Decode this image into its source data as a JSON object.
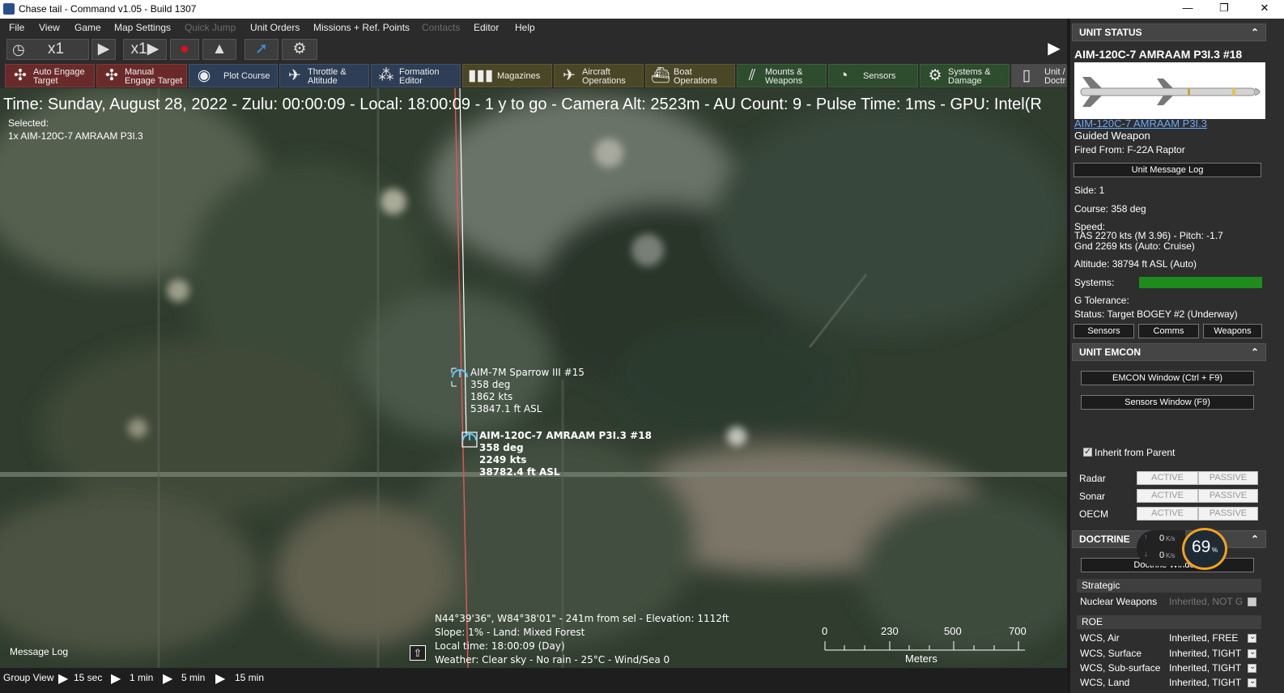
{
  "window": {
    "title": "Chase tail - Command v1.05 - Build 1307",
    "minimize_label": "—",
    "restore_label": "❐",
    "close_label": "✕"
  },
  "menu": {
    "items": [
      "File",
      "View",
      "Game",
      "Map Settings",
      "Quick Jump",
      "Unit Orders",
      "Missions + Ref. Points",
      "Contacts",
      "Editor",
      "Help"
    ]
  },
  "toolbar": {
    "time_mult_1": "x1",
    "time_mult_2": "x1"
  },
  "toolbar2": {
    "buttons": [
      {
        "line1": "Auto Engage",
        "line2": "Target"
      },
      {
        "line1": "Manual",
        "line2": "Engage Target"
      },
      {
        "line1": "Plot Course",
        "line2": ""
      },
      {
        "line1": "Throttle &",
        "line2": "Altitude"
      },
      {
        "line1": "Formation",
        "line2": "Editor"
      },
      {
        "line1": "Magazines",
        "line2": ""
      },
      {
        "line1": "Aircraft",
        "line2": "Operations"
      },
      {
        "line1": "Boat",
        "line2": "Operations"
      },
      {
        "line1": "Mounts &",
        "line2": "Weapons"
      },
      {
        "line1": "Sensors",
        "line2": ""
      },
      {
        "line1": "Systems &",
        "line2": "Damage"
      },
      {
        "line1": "Unit /",
        "line2": "Doctr"
      }
    ]
  },
  "map": {
    "info_line": "Time: Sunday, August 28, 2022 - Zulu: 00:00:09 - Local: 18:00:09 - 1 y to go -  Camera Alt: 2523m  - AU Count: 9 - Pulse Time: 1ms - GPU: Intel(R",
    "selected_label": "Selected:",
    "selected_value": "1x AIM-120C-7 AMRAAM P3I.3",
    "unit1": {
      "name": "AIM-7M Sparrow III #15",
      "course": "358 deg",
      "speed": "1862 kts",
      "alt": "53847.1 ft ASL"
    },
    "unit2": {
      "name": "AIM-120C-7 AMRAAM P3I.3 #18",
      "course": "358 deg",
      "speed": "2249 kts",
      "alt": "38782.4 ft ASL"
    },
    "coord_line1": "N44°39'36\", W84°38'01\" - 241m from sel - Elevation: 1112ft",
    "coord_line2": "Slope: 1%  - Land: Mixed Forest",
    "coord_line3": "Local time: 18:00:09 (Day)",
    "coord_line4": "Weather: Clear sky - No rain - 25°C - Wind/Sea 0",
    "scale": {
      "ticks": [
        "0",
        "230",
        "500",
        "700"
      ],
      "unit": "Meters"
    },
    "message_log": "Message Log"
  },
  "bottombar": {
    "group_view": "Group View",
    "steps": [
      "15 sec",
      "1 min",
      "5 min",
      "15 min"
    ]
  },
  "panel": {
    "unit_status_header": "UNIT STATUS",
    "unit_title": "AIM-120C-7 AMRAAM P3I.3 #18",
    "unit_link": "AIM-120C-7 AMRAAM P3I.3",
    "unit_type": "Guided Weapon",
    "fired_from": "Fired From: F-22A Raptor",
    "msg_log_btn": "Unit Message Log",
    "side": "Side: 1",
    "course": "Course: 358 deg",
    "speed_label": "Speed:",
    "speed_tas": "TAS 2270 kts (M 3.96) - Pitch: -1.7",
    "speed_gnd": "Gnd 2269 kts (Auto: Cruise)",
    "altitude": "Altitude: 38794 ft ASL (Auto)",
    "systems_label": "Systems:",
    "systems_level": 1.0,
    "g_tolerance": "G Tolerance:",
    "status": "Status: Target BOGEY #2 (Underway)",
    "tab_sensors": "Sensors",
    "tab_comms": "Comms",
    "tab_weapons": "Weapons",
    "emcon_header": "UNIT EMCON",
    "emcon_window_btn": "EMCON Window (Ctrl + F9)",
    "sensors_window_btn": "Sensors Window (F9)",
    "inherit_label": "Inherit from Parent",
    "emcon_rows": [
      {
        "label": "Radar",
        "active": "ACTIVE",
        "passive": "PASSIVE"
      },
      {
        "label": "Sonar",
        "active": "ACTIVE",
        "passive": "PASSIVE"
      },
      {
        "label": "OECM",
        "active": "ACTIVE",
        "passive": "PASSIVE"
      }
    ],
    "doctrine_header": "DOCTRINE",
    "doctrine_window_btn": "Doctrine Window",
    "strategic_label": "Strategic",
    "nuclear_label": "Nuclear Weapons",
    "nuclear_value": "Inherited, NOT G",
    "roe_label": "ROE",
    "roe_rows": [
      {
        "label": "WCS, Air",
        "value": "Inherited, FREE"
      },
      {
        "label": "WCS, Surface",
        "value": "Inherited, TIGHT"
      },
      {
        "label": "WCS, Sub-surface",
        "value": "Inherited, TIGHT"
      },
      {
        "label": "WCS, Land",
        "value": "Inherited, TIGHT"
      }
    ]
  },
  "net_gauge": {
    "up": "0",
    "down": "0",
    "unit": "K/s",
    "percent": "69",
    "percent_sign": "%"
  },
  "colors": {
    "accent_red": "#6b2a2a",
    "systems_green": "#1d8c1d",
    "link_blue": "#6aa8ff",
    "gauge_orange": "#f3a21c"
  }
}
